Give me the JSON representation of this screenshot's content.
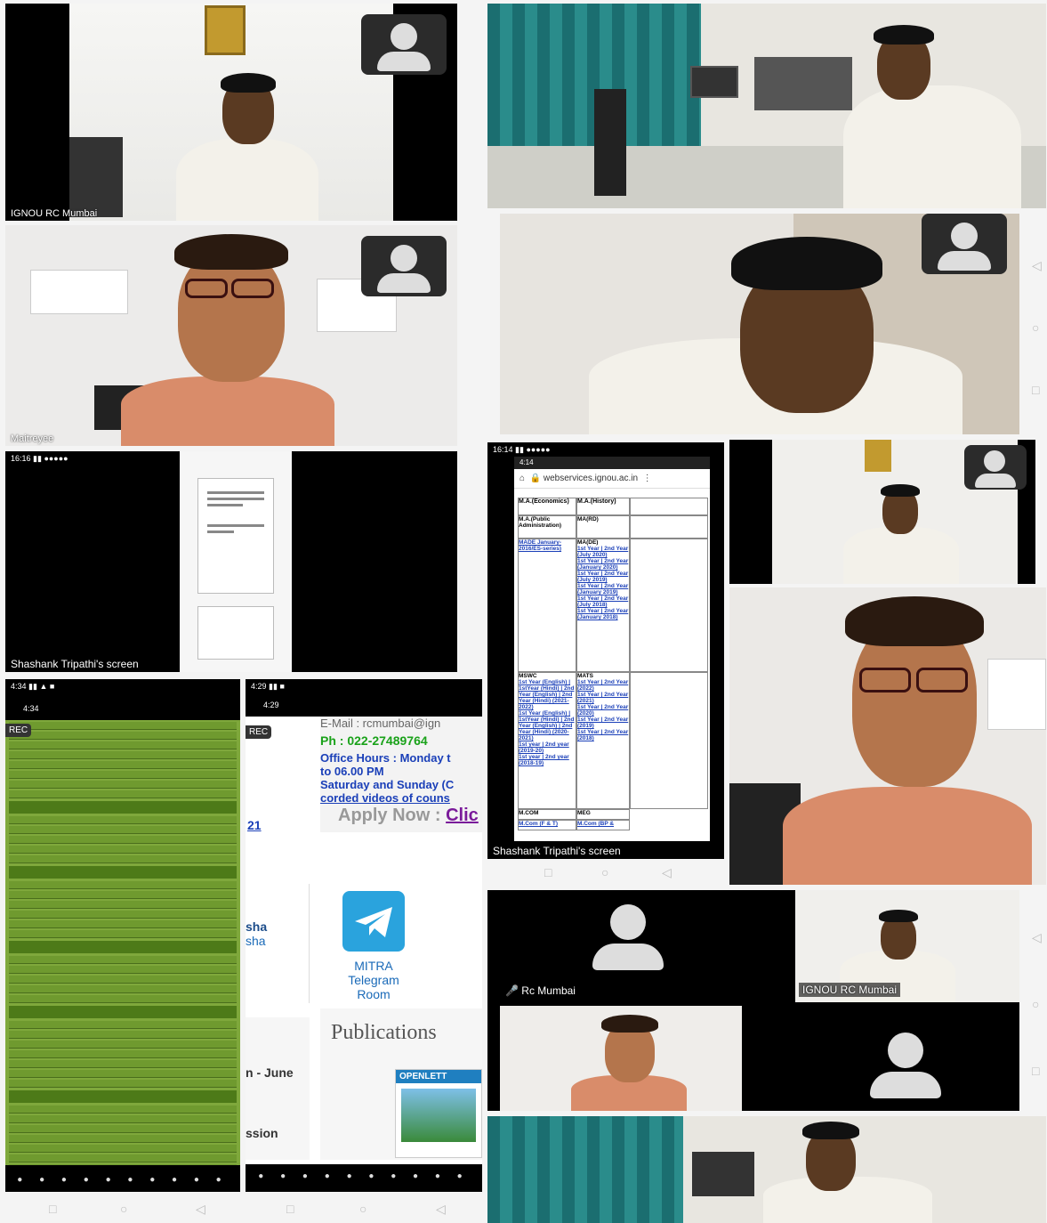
{
  "tiles": {
    "top_left": {
      "name": "IGNOU RC Mumbai"
    },
    "mid_left": {
      "name": "Maitreyee"
    },
    "screen_share_1": {
      "status": "16:16",
      "caption": "Shashank Tripathi's screen"
    },
    "screen_share_2": {
      "status_outer": "16:14",
      "status_inner": "4:14",
      "url": "webservices.ignou.ac.in",
      "caption": "Shashank Tripathi's screen",
      "table": {
        "headers": [
          "M.A.(Economics)",
          "M.A.(History)"
        ],
        "row2": [
          "M.A.(Public Administration)",
          "MA(RD)"
        ],
        "row3_left": "MADE January-2016/ES-series)",
        "row3_mid": "MA(DE)",
        "mid_links": [
          "1st Year | 2nd Year (July 2020)",
          "1st Year | 2nd Year (January 2020)",
          "1st Year | 2nd Year (July 2019)",
          "1st Year | 2nd Year (January 2019)",
          "1st Year | 2nd Year (July 2018)",
          "1st Year | 2nd Year (January 2018)"
        ],
        "row4_left": "MSWC",
        "row4_mid": "MATS",
        "left_links": [
          "1st Year (English) | 1stYear (Hindi) | 2nd Year (English) | 2nd Year (Hindi) (2021-2022)",
          "1st Year (English) | 1stYear (Hindi) | 2nd Year (English) | 2nd Year (Hindi) (2020-2021)",
          "1st year | 2nd year (2019-20)",
          "1st year | 2nd year (2018-19)"
        ],
        "mats_links": [
          "1st Year | 2nd Year (2022)",
          "1st Year | 2nd Year (2021)",
          "1st Year | 2nd Year (2020)",
          "1st Year | 2nd Year (2019)",
          "1st Year | 2nd Year (2018)"
        ],
        "row5": [
          "M.COM",
          "MEG"
        ],
        "row6": [
          "M.Com (F & T)",
          "M.Com (BP &"
        ]
      }
    },
    "phone_left": {
      "status": "4:34",
      "time": "4:34",
      "rec": "REC"
    },
    "phone_right": {
      "status": "4:29",
      "time": "4:29",
      "rec": "REC",
      "email": "E-Mail : rcmumbai@ign",
      "phone": "Ph : 022-27489764",
      "hours1": "Office Hours : Monday t",
      "hours2": "to 06.00 PM",
      "hours3": "Saturday and Sunday (C",
      "recorded": "corded videos of couns",
      "apply": "Apply Now : ",
      "apply_link": "Clic",
      "small_21": "21",
      "sha": "sha",
      "sha2": "sha",
      "mitra": "MITRA",
      "telegram": "Telegram",
      "room": "Room",
      "publications": "Publications",
      "june": "n - June",
      "ssion": "ssion",
      "openletter": "OPENLETT"
    },
    "bottom_grid": {
      "rc_mumbai": "Rc Mumbai",
      "ignou": "IGNOU RC Mumbai"
    }
  },
  "colors": {
    "green": "#6f9a2f",
    "telegram": "#2aa3dd",
    "phone_green": "#1aa21a",
    "link_blue": "#1a3fb8"
  }
}
